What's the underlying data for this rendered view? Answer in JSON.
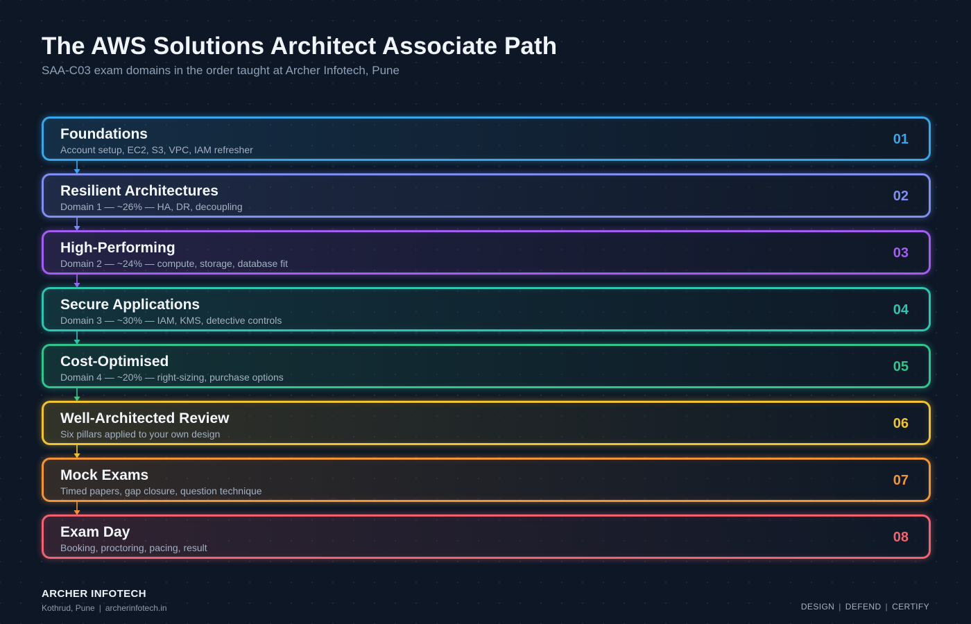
{
  "header": {
    "title": "The AWS Solutions Architect Associate Path",
    "subtitle": "SAA-C03 exam domains in the order taught at Archer Infotech, Pune"
  },
  "steps": [
    {
      "number": "01",
      "title": "Foundations",
      "description": "Account setup, EC2, S3, VPC, IAM refresher",
      "accent": "#3aa6e8"
    },
    {
      "number": "02",
      "title": "Resilient Architectures",
      "description": "Domain 1 — ~26% — HA, DR, decoupling",
      "accent": "#7e8ff0"
    },
    {
      "number": "03",
      "title": "High-Performing",
      "description": "Domain 2 — ~24% — compute, storage, database fit",
      "accent": "#a25ef0"
    },
    {
      "number": "04",
      "title": "Secure Applications",
      "description": "Domain 3 — ~30% — IAM, KMS, detective controls",
      "accent": "#2ec4b0"
    },
    {
      "number": "05",
      "title": "Cost-Optimised",
      "description": "Domain 4 — ~20% — right-sizing, purchase options",
      "accent": "#33c38c"
    },
    {
      "number": "06",
      "title": "Well-Architected Review",
      "description": "Six pillars applied to your own design",
      "accent": "#f1c232"
    },
    {
      "number": "07",
      "title": "Mock Exams",
      "description": "Timed papers, gap closure, question technique",
      "accent": "#f0953a"
    },
    {
      "number": "08",
      "title": "Exam Day",
      "description": "Booking, proctoring, pacing, result",
      "accent": "#ef6470"
    }
  ],
  "footer": {
    "brand": "ARCHER INFOTECH",
    "location": "Kothrud, Pune",
    "website": "archerinfotech.in",
    "tagline": [
      "DESIGN",
      "DEFEND",
      "CERTIFY"
    ]
  }
}
